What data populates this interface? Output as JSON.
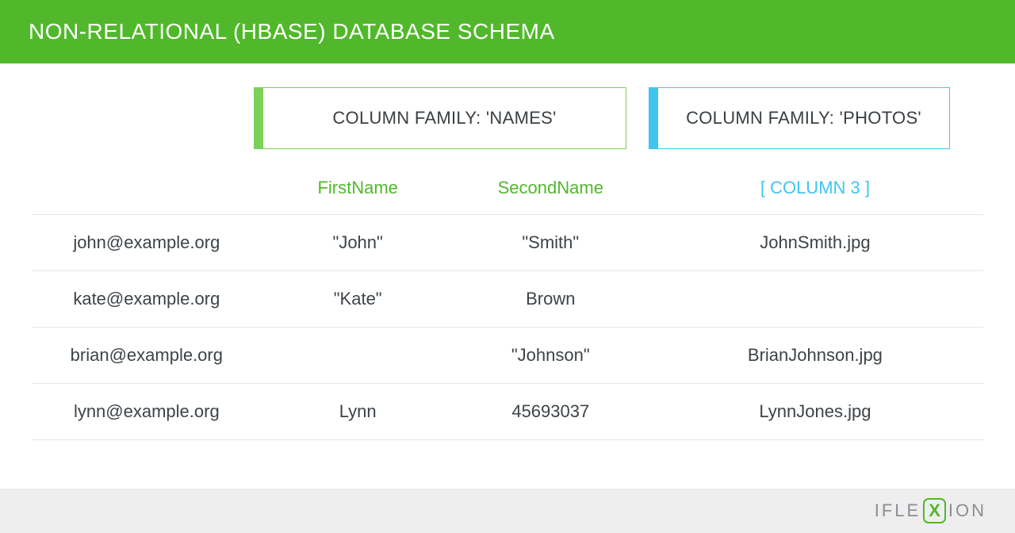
{
  "header": {
    "title": "NON-RELATIONAL (HBASE) DATABASE SCHEMA"
  },
  "column_families": {
    "names": {
      "label": "COLUMN FAMILY: 'NAMES'"
    },
    "photos": {
      "label": "COLUMN FAMILY: 'PHOTOS'"
    }
  },
  "columns": {
    "first_name": "FirstName",
    "second_name": "SecondName",
    "photo": "[ COLUMN 3 ]"
  },
  "rows": [
    {
      "key": "john@example.org",
      "first": "\"John\"",
      "second": "\"Smith\"",
      "photo": "JohnSmith.jpg"
    },
    {
      "key": "kate@example.org",
      "first": "\"Kate\"",
      "second": "Brown",
      "photo": ""
    },
    {
      "key": "brian@example.org",
      "first": "",
      "second": "\"Johnson\"",
      "photo": "BrianJohnson.jpg"
    },
    {
      "key": "lynn@example.org",
      "first": "Lynn",
      "second": "45693037",
      "photo": "LynnJones.jpg"
    }
  ],
  "footer": {
    "logo_left": "IFLE",
    "logo_x": "X",
    "logo_right": "ION"
  },
  "colors": {
    "green": "#51b82b",
    "green_light": "#7bd15a",
    "cyan": "#3ec6f0"
  }
}
